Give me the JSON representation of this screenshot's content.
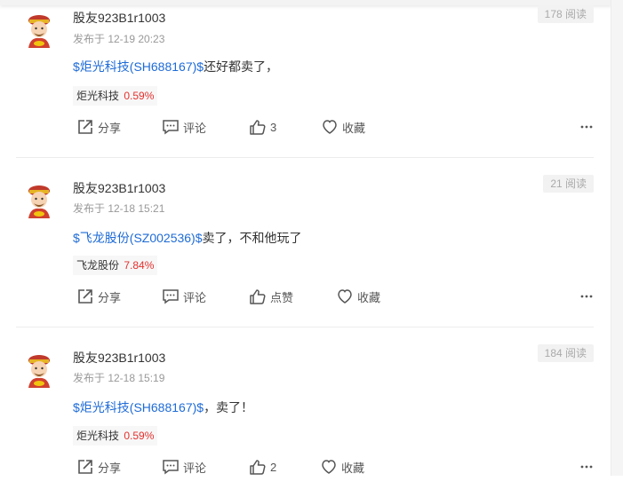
{
  "posts": [
    {
      "author": "股友923B1r1003",
      "time": "发布于 12-19 20:23",
      "views": "178 阅读",
      "stock_ref": "$炬光科技(SH688167)$",
      "text": "还好都卖了，",
      "tag_name": "炬光科技",
      "tag_pct": "0.59%",
      "share_label": "分享",
      "comment_label": "评论",
      "like_label": "3",
      "fav_label": "收藏"
    },
    {
      "author": "股友923B1r1003",
      "time": "发布于 12-18 15:21",
      "views": "21 阅读",
      "stock_ref": "$飞龙股份(SZ002536)$",
      "text": "卖了，不和他玩了",
      "tag_name": "飞龙股份",
      "tag_pct": "7.84%",
      "share_label": "分享",
      "comment_label": "评论",
      "like_label": "点赞",
      "fav_label": "收藏"
    },
    {
      "author": "股友923B1r1003",
      "time": "发布于 12-18 15:19",
      "views": "184 阅读",
      "stock_ref": "$炬光科技(SH688167)$",
      "text": "，卖了！",
      "tag_name": "炬光科技",
      "tag_pct": "0.59%",
      "share_label": "分享",
      "comment_label": "评论",
      "like_label": "2",
      "fav_label": "收藏"
    }
  ],
  "icons": {
    "share": "share-icon",
    "comment": "comment-icon",
    "like": "thumbs-up-icon",
    "favorite": "heart-icon",
    "more": "more-dots-icon",
    "avatar": "caishen-avatar"
  },
  "colors": {
    "stock_link": "#1e6bd6",
    "percent_up": "#e5302d",
    "muted": "#999999"
  }
}
